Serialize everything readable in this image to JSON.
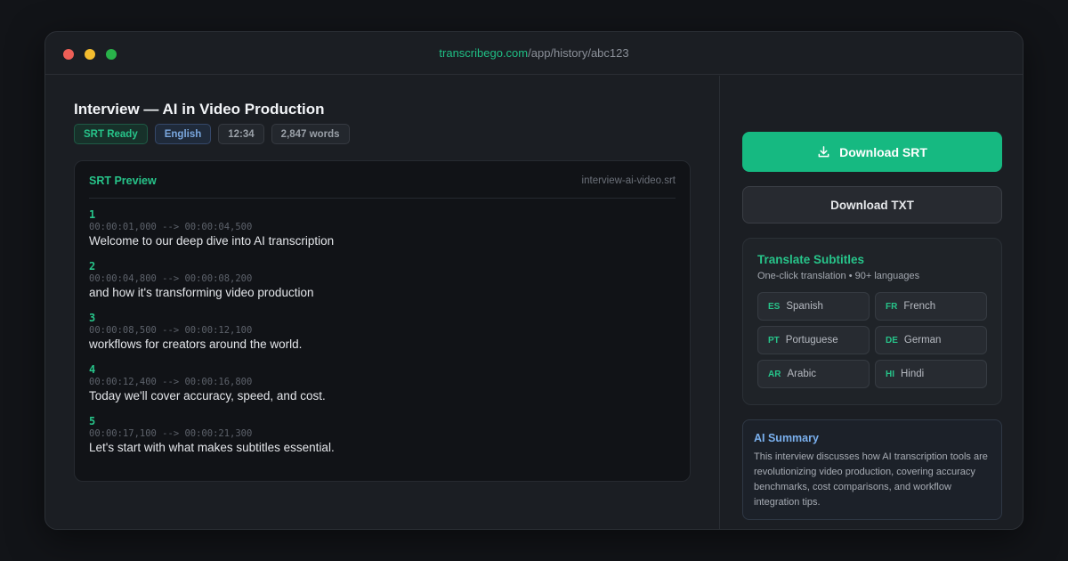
{
  "browser": {
    "url_domain": "transcribego.com",
    "url_path": "/app/history/abc123"
  },
  "header": {
    "title": "Interview — AI in Video Production",
    "badges": {
      "status": "SRT Ready",
      "language": "English",
      "duration": "12:34",
      "words": "2,847 words"
    }
  },
  "preview": {
    "title": "SRT Preview",
    "filename": "interview-ai-video.srt",
    "cues": [
      {
        "num": "1",
        "time": "00:00:01,000 --> 00:00:04,500",
        "text": "Welcome to our deep dive into AI transcription"
      },
      {
        "num": "2",
        "time": "00:00:04,800 --> 00:00:08,200",
        "text": "and how it's transforming video production"
      },
      {
        "num": "3",
        "time": "00:00:08,500 --> 00:00:12,100",
        "text": "workflows for creators around the world."
      },
      {
        "num": "4",
        "time": "00:00:12,400 --> 00:00:16,800",
        "text": "Today we'll cover accuracy, speed, and cost."
      },
      {
        "num": "5",
        "time": "00:00:17,100 --> 00:00:21,300",
        "text": "Let's start with what makes subtitles essential."
      }
    ]
  },
  "actions": {
    "download_srt": "Download SRT",
    "download_srt_icon": "download-icon",
    "download_txt": "Download TXT"
  },
  "translate": {
    "title": "Translate Subtitles",
    "subtitle": "One-click translation • 90+ languages",
    "languages": [
      {
        "code": "ES",
        "name": "Spanish"
      },
      {
        "code": "FR",
        "name": "French"
      },
      {
        "code": "PT",
        "name": "Portuguese"
      },
      {
        "code": "DE",
        "name": "German"
      },
      {
        "code": "AR",
        "name": "Arabic"
      },
      {
        "code": "HI",
        "name": "Hindi"
      }
    ]
  },
  "summary": {
    "title": "AI Summary",
    "text": "This interview discusses how AI transcription tools are revolutionizing video production, covering accuracy benchmarks, cost comparisons, and workflow integration tips."
  },
  "colors": {
    "accent": "#16b981",
    "background": "#121418",
    "panel": "#1b1e23",
    "summary_accent": "#7ab0ee"
  }
}
